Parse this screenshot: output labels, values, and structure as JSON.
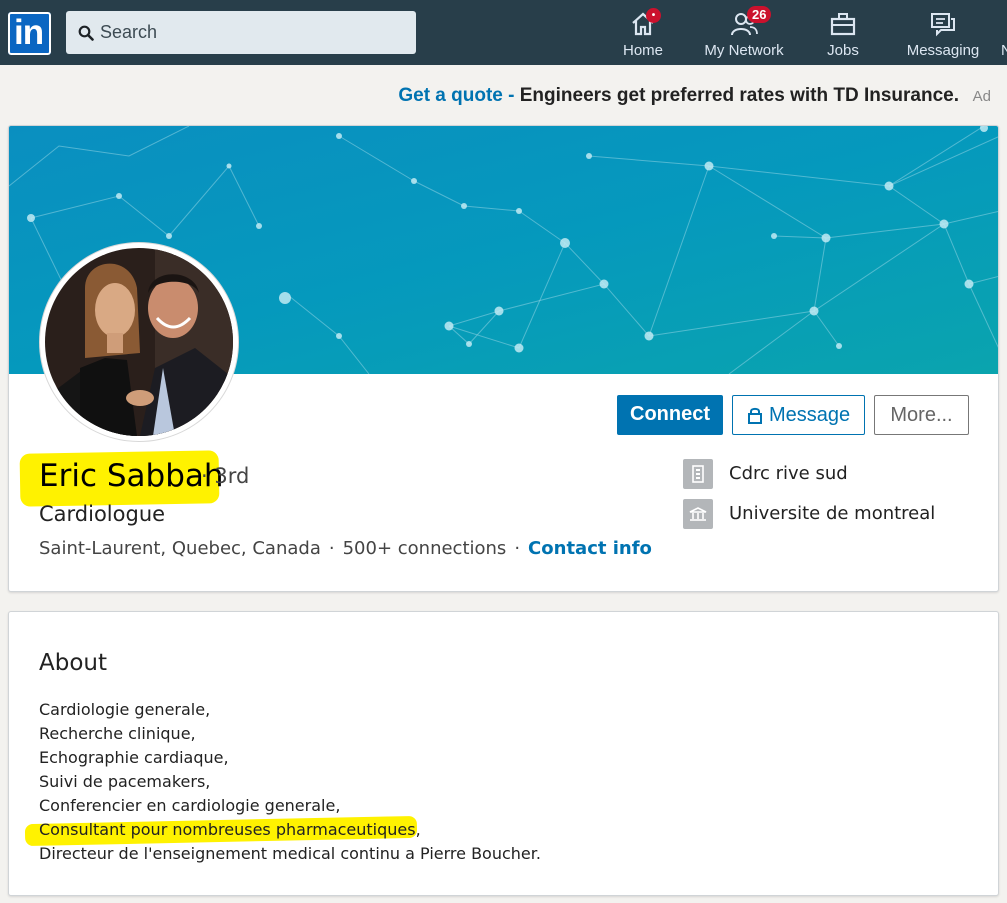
{
  "nav": {
    "logo_text": "in",
    "search_placeholder": "Search",
    "items": [
      {
        "label": "Home",
        "badge": "•"
      },
      {
        "label": "My Network",
        "badge": "26"
      },
      {
        "label": "Jobs",
        "badge": ""
      },
      {
        "label": "Messaging",
        "badge": ""
      },
      {
        "label": "N",
        "badge": ""
      }
    ]
  },
  "ad": {
    "link": "Get a quote",
    "sep": " - ",
    "text": "Engineers get preferred rates with TD Insurance.",
    "label": "Ad"
  },
  "profile": {
    "name": "Eric Sabbah",
    "degree": "· 3rd",
    "headline": "Cardiologue",
    "location": "Saint-Laurent, Quebec, Canada",
    "connections": "500+ connections",
    "contact": "Contact info",
    "dot": "·",
    "buttons": {
      "connect": "Connect",
      "message": "Message",
      "more": "More..."
    },
    "affiliations": [
      {
        "icon": "building-icon",
        "text": "Cdrc rive sud"
      },
      {
        "icon": "school-icon",
        "text": "Universite de montreal"
      }
    ]
  },
  "about": {
    "title": "About",
    "lines": [
      "Cardiologie generale,",
      "Recherche clinique,",
      "Echographie cardiaque,",
      "Suivi de pacemakers,",
      "Conferencier en cardiologie generale,",
      "Consultant pour nombreuses pharmaceutiques,",
      "Directeur de l'enseignement medical continu a Pierre Boucher."
    ]
  },
  "colors": {
    "nav_bg": "#283e4a",
    "brand_blue": "#0073b1",
    "highlight": "#fff200",
    "badge_red": "#cb112d"
  }
}
